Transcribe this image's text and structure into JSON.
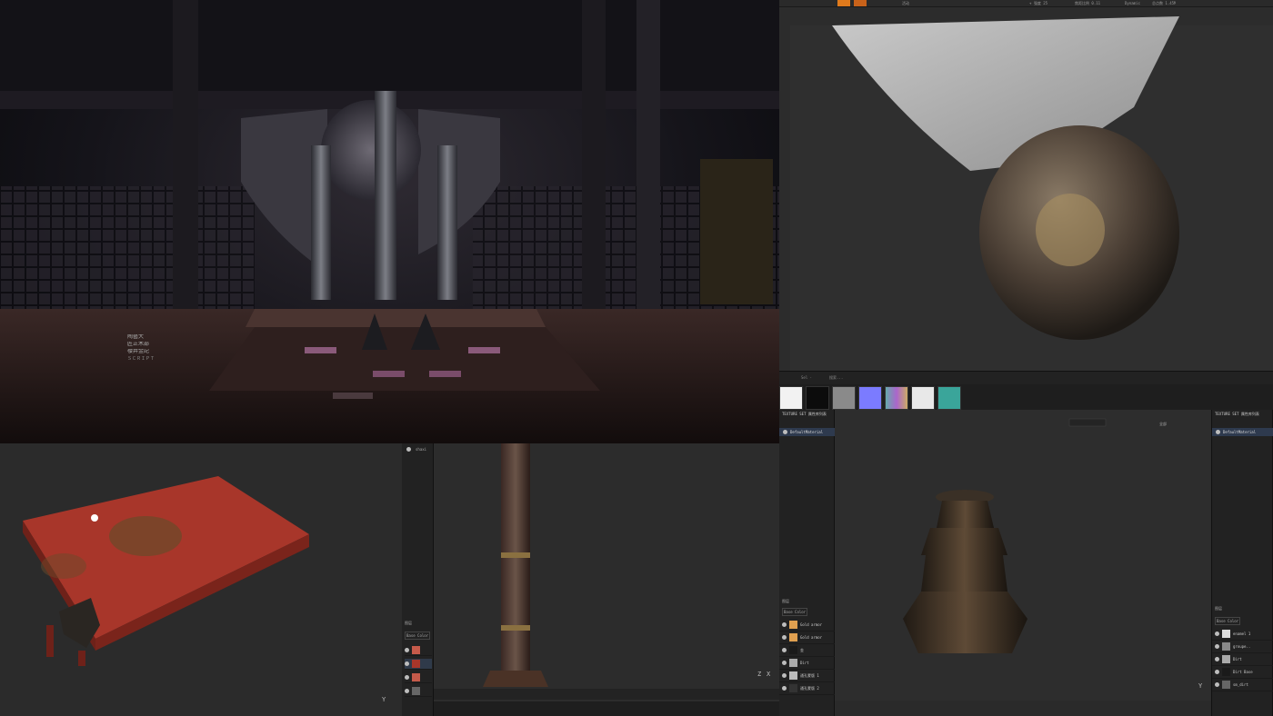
{
  "scene": {
    "calligraphy": [
      "陶藝大",
      "匠正木部",
      "櫻井金記",
      "ＳＣＲＩＰＴ"
    ]
  },
  "zbrush": {
    "top_labels": [
      "活动",
      "目标",
      "+ 强度 25",
      "焦距比例 0.11",
      "Dynamic",
      "总点数 1.45M"
    ],
    "bottom_tabs": [
      "Sel · ",
      "搜索..."
    ],
    "materials": [
      {
        "name": "white",
        "color": "#f2f2f2"
      },
      {
        "name": "black",
        "color": "#0c0c0c"
      },
      {
        "name": "gray-noise",
        "color": "#8a8a8a"
      },
      {
        "name": "normal",
        "color": "#7b7bff"
      },
      {
        "name": "colorful",
        "color": "#6aa"
      },
      {
        "name": "paper",
        "color": "#e8e8e8"
      },
      {
        "name": "teal",
        "color": "#3aa59a"
      }
    ]
  },
  "painter_left": {
    "object_label": "shaxi",
    "layers_title": "图层",
    "channel": "Base Color",
    "axis_labels": [
      "Y",
      "X",
      "Z"
    ]
  },
  "painter_right": {
    "texture_set_title_a": "TEXTURE SET 属性库列表",
    "texture_set_title_b": "TEXTURE SET 属性库列表",
    "material_a": "DefaultMaterial",
    "material_b": "DefaultMaterial",
    "dropdown": "全部",
    "layers_title": "图层",
    "channel": "Base Color",
    "layers_a": [
      "Gold armor",
      "Gold armor",
      "金",
      "脏迹",
      "Dirt",
      "通孔蒙版 1",
      "通孔蒙版 2",
      "通孔"
    ],
    "layers_b": [
      "enamel 1",
      "groupe..",
      "sm_mask_a",
      "sm_mask_b",
      "Dirt",
      "Dirt Base",
      "Chassis",
      "sm_dirt"
    ]
  },
  "colors": {
    "table_red": "#a8362a",
    "gold": "#c9a25a",
    "accent_orange": "#e07a1c"
  }
}
